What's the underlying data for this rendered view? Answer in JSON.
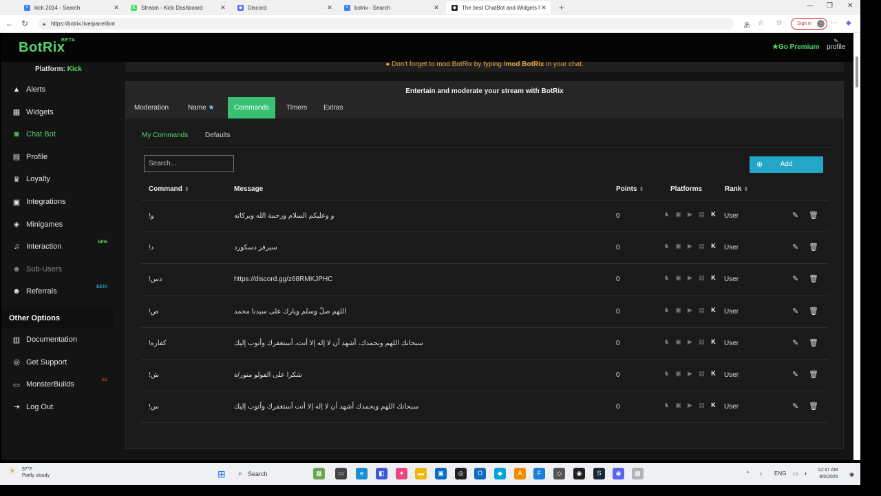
{
  "browser": {
    "tabs": [
      {
        "title": "kick 2014 - Search",
        "icon_color": "#3b82f6",
        "icon_glyph": "⌕",
        "active": false
      },
      {
        "title": "Stream - Kick Dashboard",
        "icon_color": "#53d769",
        "icon_glyph": "K",
        "active": false
      },
      {
        "title": "Discord",
        "icon_color": "#5865f2",
        "icon_glyph": "◉",
        "active": false
      },
      {
        "title": "botrix - Search",
        "icon_color": "#3b82f6",
        "icon_glyph": "⌕",
        "active": false
      },
      {
        "title": "The best ChatBot and Widgets fo",
        "icon_color": "#222222",
        "icon_glyph": "◆",
        "active": true
      }
    ],
    "new_tab": "+",
    "url": "https://botrix.live/panel/bot",
    "sign_in": "Sign in"
  },
  "app": {
    "logo": "BotRix",
    "logo_badge": "BETA",
    "premium": "Go Premium",
    "profile": "profile",
    "platform_label": "Platform: ",
    "platform_value": "Kick",
    "nav": [
      {
        "label": "Alerts",
        "icon": "alert-icon",
        "glyph": "▲",
        "active": false,
        "disabled": false,
        "badge": "",
        "badge_color": ""
      },
      {
        "label": "Widgets",
        "icon": "widgets-icon",
        "glyph": "▦",
        "active": false,
        "disabled": false,
        "badge": "",
        "badge_color": ""
      },
      {
        "label": "Chat Bot",
        "icon": "robot-icon",
        "glyph": "◙",
        "active": true,
        "disabled": false,
        "badge": "",
        "badge_color": ""
      },
      {
        "label": "Profile",
        "icon": "id-card-icon",
        "glyph": "▤",
        "active": false,
        "disabled": false,
        "badge": "",
        "badge_color": ""
      },
      {
        "label": "Loyalty",
        "icon": "trophy-icon",
        "glyph": "♛",
        "active": false,
        "disabled": false,
        "badge": "",
        "badge_color": ""
      },
      {
        "label": "Integrations",
        "icon": "integrations-icon",
        "glyph": "▣",
        "active": false,
        "disabled": false,
        "badge": "",
        "badge_color": ""
      },
      {
        "label": "Minigames",
        "icon": "gamepad-icon",
        "glyph": "◈",
        "active": false,
        "disabled": false,
        "badge": "",
        "badge_color": ""
      },
      {
        "label": "Interaction",
        "icon": "music-icon",
        "glyph": "♫",
        "active": false,
        "disabled": false,
        "badge": "NEW",
        "badge_color": "#53d769"
      },
      {
        "label": "Sub-Users",
        "icon": "users-icon",
        "glyph": "☻",
        "active": false,
        "disabled": true,
        "badge": "",
        "badge_color": ""
      },
      {
        "label": "Referrals",
        "icon": "referrals-icon",
        "glyph": "☻",
        "active": false,
        "disabled": false,
        "badge": "BETA",
        "badge_color": "#23a6c8"
      }
    ],
    "other_options_title": "Other Options",
    "other_nav": [
      {
        "label": "Documentation",
        "icon": "book-icon",
        "glyph": "▥",
        "badge": "",
        "badge_color": ""
      },
      {
        "label": "Get Support",
        "icon": "support-icon",
        "glyph": "◎",
        "badge": "",
        "badge_color": ""
      },
      {
        "label": "MonsterBuilds",
        "icon": "monitor-icon",
        "glyph": "▭",
        "badge": "AD",
        "badge_color": "#c0392b"
      },
      {
        "label": "Log Out",
        "icon": "logout-icon",
        "glyph": "⇥",
        "badge": "",
        "badge_color": ""
      }
    ]
  },
  "notice": {
    "prefix": "Don't forget to mod BotRix by typing ",
    "command": "/mod BotRix",
    "suffix": " in your chat."
  },
  "panel": {
    "title": "Entertain and moderate your stream with BotRix",
    "tabs": [
      "Moderation",
      "Name",
      "Commands",
      "Timers",
      "Extras"
    ],
    "active_tab": "Commands",
    "subtabs": [
      "My Commands",
      "Defaults"
    ],
    "search_placeholder": "Search...",
    "add_label": "Add",
    "columns": {
      "command": "Command",
      "message": "Message",
      "points": "Points",
      "platforms": "Platforms",
      "rank": "Rank"
    },
    "rows": [
      {
        "command": "!و",
        "message": "و وعليكم السلام ورحمة الله وبركاته",
        "points": "0",
        "rank": "User"
      },
      {
        "command": "!د",
        "message": "سيرفر دسكورد",
        "points": "0",
        "rank": "User"
      },
      {
        "command": "!دس",
        "message": "https://discord.gg/z68RMKJPHC",
        "points": "0",
        "rank": "User"
      },
      {
        "command": "!ص",
        "message": "اللهم صلّ وسلم وبارك على سيدنا محمد",
        "points": "0",
        "rank": "User"
      },
      {
        "command": "!كفاره",
        "message": "سبحانك اللهم وبحمدك، أشهد أن لا إله إلا أنت، أستغفرك وأتوب إليك",
        "points": "0",
        "rank": "User"
      },
      {
        "command": "!ش",
        "message": "شكرا على الفولو منور/ة",
        "points": "0",
        "rank": "User"
      },
      {
        "command": "!س",
        "message": "سبحانك اللهم وبحمدك أشهد أن لا إله إلا أنت أستغفرك وأتوب إليك",
        "points": "0",
        "rank": "User"
      }
    ]
  },
  "taskbar": {
    "temperature": "97°F",
    "weather": "Partly cloudy",
    "search": "Search",
    "lang": "ENG",
    "time": "12:47 AM",
    "date": "8/5/2025"
  }
}
